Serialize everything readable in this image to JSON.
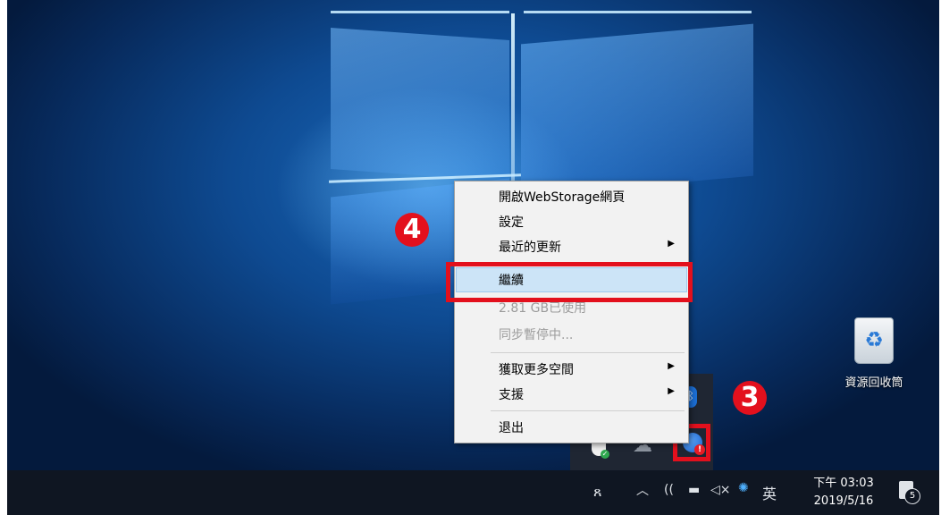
{
  "desktop": {
    "recycle_bin_label": "資源回收筒"
  },
  "context_menu": {
    "items": [
      {
        "label": "開啟WebStorage網頁",
        "enabled": true,
        "submenu": false
      },
      {
        "label": "設定",
        "enabled": true,
        "submenu": false
      },
      {
        "label": "最近的更新",
        "enabled": true,
        "submenu": true
      },
      {
        "label": "繼續",
        "enabled": true,
        "submenu": false,
        "highlighted": true
      },
      {
        "label": "2.81 GB已使用",
        "enabled": false,
        "submenu": false
      },
      {
        "label": "同步暫停中...",
        "enabled": false,
        "submenu": false
      },
      {
        "label": "獲取更多空間",
        "enabled": true,
        "submenu": true
      },
      {
        "label": "支援",
        "enabled": true,
        "submenu": true
      },
      {
        "label": "退出",
        "enabled": true,
        "submenu": false
      }
    ]
  },
  "annotations": {
    "step_menu": "4",
    "step_tray": "3",
    "color": "#e3101d"
  },
  "tray_overflow": {
    "icons": [
      "bluetooth-icon",
      "defender-icon",
      "onedrive-icon",
      "webstorage-icon"
    ]
  },
  "taskbar": {
    "people_icon": "ጸ",
    "chevron": "︿",
    "ime": "英",
    "clock_time": "下午 03:03",
    "clock_date": "2019/5/16",
    "notification_count": "5"
  }
}
